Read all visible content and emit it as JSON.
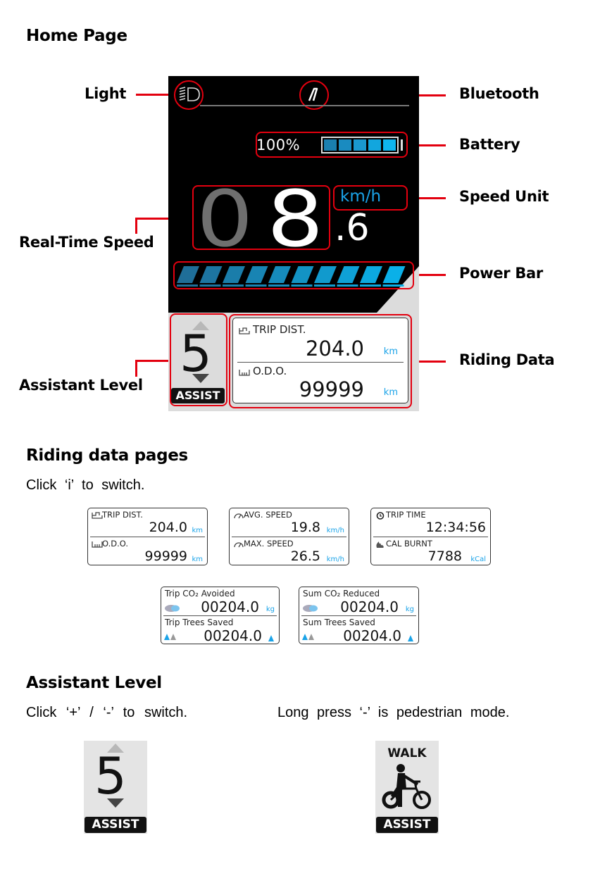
{
  "sections": {
    "home": {
      "title": "Home Page"
    },
    "riding": {
      "title": "Riding data pages",
      "instruction": "Click ‘i’ to switch."
    },
    "assist": {
      "title": "Assistant Level",
      "instruction_left": "Click ‘+’ / ‘-’ to switch.",
      "instruction_right": "Long press ‘-’ is pedestrian mode."
    }
  },
  "callouts": {
    "light": "Light",
    "bluetooth": "Bluetooth",
    "battery": "Battery",
    "speed_unit": "Speed Unit",
    "real_time_speed": "Real-Time Speed",
    "power_bar": "Power Bar",
    "assistant_level": "Assistant Level",
    "riding_data": "Riding Data"
  },
  "display": {
    "battery_percent": "100%",
    "battery_level_fraction": 1.0,
    "battery_segments": 5,
    "speed_unit": "km/h",
    "speed_dim_digit": "0",
    "speed_main_digit": "8",
    "speed_decimal": ".6",
    "power_level_fraction": 1.0,
    "power_segments": 10,
    "assist_level": "5",
    "assist_label": "ASSIST",
    "trip_label": "TRIP DIST.",
    "trip_value": "204.0",
    "trip_unit": "km",
    "odo_label": "O.D.O.",
    "odo_value": "99999",
    "odo_unit": "km",
    "colors": {
      "accent_blue": "#1aa3e8",
      "callout_red": "#e3000f"
    }
  },
  "data_pages": [
    {
      "top_label": "TRIP DIST.",
      "top_icon": "trip-icon",
      "top_value": "204.0",
      "top_unit": "km",
      "bottom_label": "O.D.O.",
      "bottom_icon": "odo-icon",
      "bottom_value": "99999",
      "bottom_unit": "km"
    },
    {
      "top_label": "AVG. SPEED",
      "top_icon": "speedometer-icon",
      "top_value": "19.8",
      "top_unit": "km/h",
      "bottom_label": "MAX. SPEED",
      "bottom_icon": "speedometer-icon",
      "bottom_value": "26.5",
      "bottom_unit": "km/h"
    },
    {
      "top_label": "TRIP TIME",
      "top_icon": "clock-icon",
      "top_value": "12:34:56",
      "top_unit": "",
      "bottom_label": "CAL BURNT",
      "bottom_icon": "flame-icon",
      "bottom_value": "7788",
      "bottom_unit": "kCal"
    },
    {
      "top_label": "Trip CO₂ Avoided",
      "top_icon": "co2-cloud-icon",
      "top_value": "00204.0",
      "top_unit": "kg",
      "bottom_label": "Trip Trees Saved",
      "bottom_icon": "trees-icon",
      "bottom_value": "00204.0",
      "bottom_unit": "tree"
    },
    {
      "top_label": "Sum CO₂ Reduced",
      "top_icon": "co2-cloud-icon",
      "top_value": "00204.0",
      "top_unit": "kg",
      "bottom_label": "Sum Trees Saved",
      "bottom_icon": "trees-icon",
      "bottom_value": "00204.0",
      "bottom_unit": "tree"
    }
  ],
  "assist_examples": {
    "level": {
      "value": "5",
      "label": "ASSIST"
    },
    "walk": {
      "title": "WALK",
      "label": "ASSIST"
    }
  }
}
